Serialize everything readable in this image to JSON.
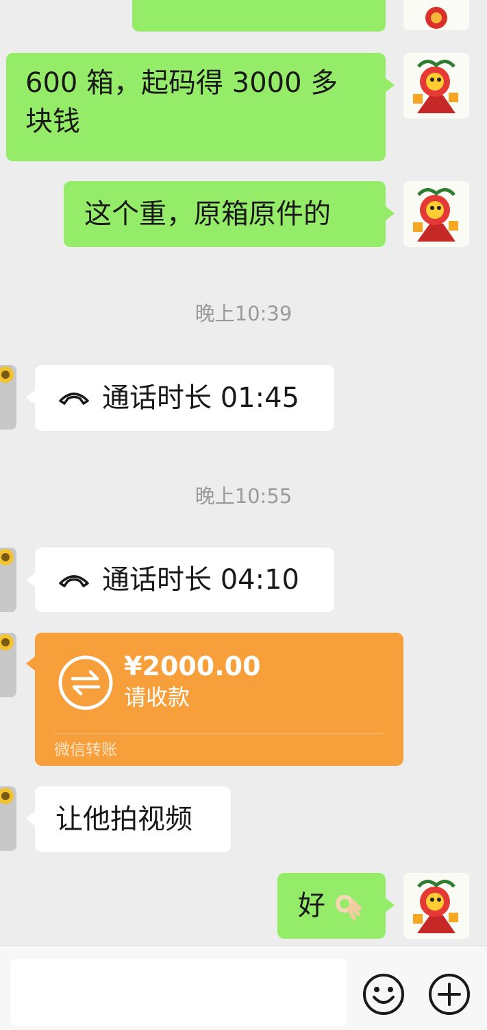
{
  "messages": [
    {
      "type": "text",
      "side": "right",
      "text": "600 箱，起码得 3000 多\n块钱"
    },
    {
      "type": "text",
      "side": "right",
      "text": "这个重，原箱原件的"
    },
    {
      "type": "timestamp",
      "text": "晚上10:39"
    },
    {
      "type": "call",
      "side": "left",
      "text": "通话时长 01:45"
    },
    {
      "type": "timestamp",
      "text": "晚上10:55"
    },
    {
      "type": "call",
      "side": "left",
      "text": "通话时长 04:10"
    },
    {
      "type": "transfer",
      "side": "left",
      "amount": "¥2000.00",
      "status": "请收款",
      "footer": "微信转账"
    },
    {
      "type": "text",
      "side": "left",
      "text": "让他拍视频"
    },
    {
      "type": "text",
      "side": "right",
      "text": "好",
      "emoji": "ok-hand-emoji"
    }
  ],
  "input_bar": {
    "placeholder": "",
    "emoji_icon": "smiley-face-icon",
    "more_icon": "plus-circle-icon"
  },
  "colors": {
    "background": "#ededed",
    "bubble_self": "#95ec69",
    "bubble_peer": "#ffffff",
    "transfer": "#f7a03b"
  }
}
